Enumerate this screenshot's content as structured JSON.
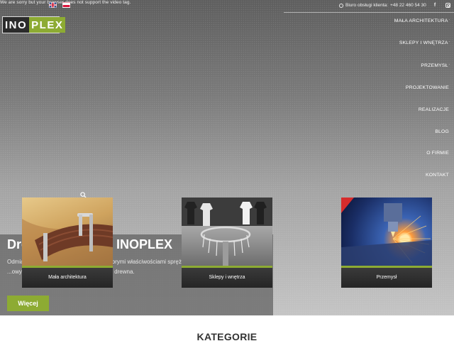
{
  "video_message": "We are sorry but your browser does not support the video tag.",
  "languages": [
    {
      "code": "en",
      "icon": "uk-flag-icon"
    },
    {
      "code": "pl",
      "icon": "pl-flag-icon"
    }
  ],
  "contact": {
    "label": "Biuro obsługi klienta:",
    "phone": "+48 22 460 54 30",
    "icon": "phone-icon"
  },
  "social": {
    "facebook": "f",
    "instagram_icon": "instagram-icon"
  },
  "logo": {
    "part1": "INO",
    "part2": "PLEX",
    "accent_color": "#8dab33"
  },
  "menu": [
    {
      "label": "MAŁA ARCHITEKTURA"
    },
    {
      "label": "SKLEPY I WNĘTRZA"
    },
    {
      "label": "PRZEMYSŁ"
    },
    {
      "label": "PROJEKTOWANIE"
    },
    {
      "label": "REALIZACJE"
    },
    {
      "label": "BLOG"
    },
    {
      "label": "O FIRMIE"
    },
    {
      "label": "KONTAKT"
    }
  ],
  "hero": {
    "title": "Drewno w ofercie INOPLEX",
    "text": "Odmiana drewna ... charakteryzuje się dobrymi właściwościami spręż... w ...owym areale leśnym, jak... popu... ...ych drewna.",
    "button": "Więcej"
  },
  "categories": [
    {
      "label": "Mała architektura"
    },
    {
      "label": "Sklepy i wnętrza"
    },
    {
      "label": "Przemysł"
    }
  ],
  "categories_heading": "KATEGORIE"
}
